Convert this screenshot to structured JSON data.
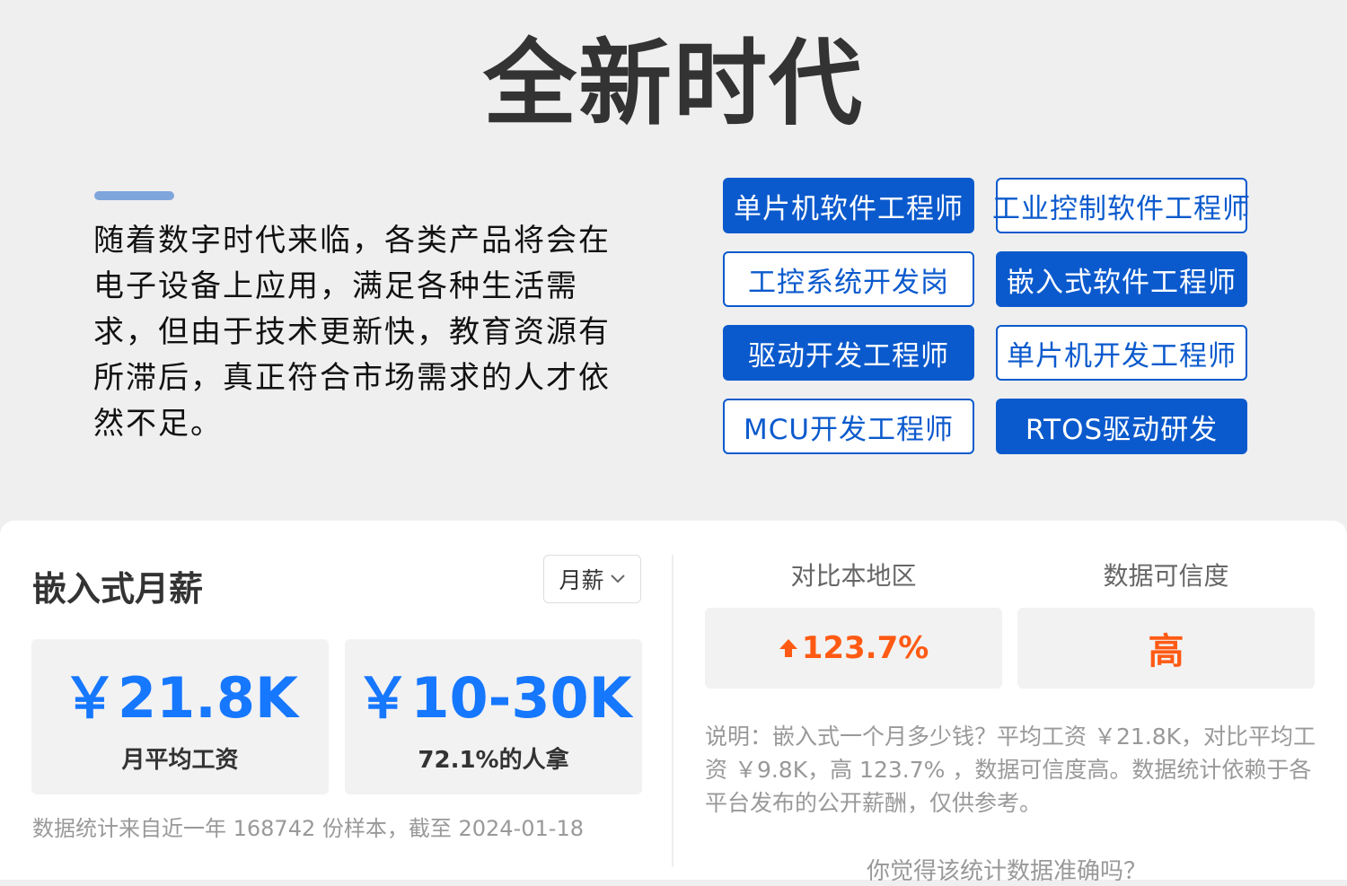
{
  "hero": {
    "title": "全新时代",
    "intro": "随着数字时代来临，各类产品将会在电子设备上应用，满足各种生活需求，但由于技术更新快，教育资源有所滞后，真正符合市场需求的人才依然不足。"
  },
  "tags": [
    {
      "label": "单片机软件工程师",
      "style": "filled"
    },
    {
      "label": "工业控制软件工程师",
      "style": "outline"
    },
    {
      "label": "工控系统开发岗",
      "style": "outline"
    },
    {
      "label": "嵌入式软件工程师",
      "style": "filled"
    },
    {
      "label": "驱动开发工程师",
      "style": "filled"
    },
    {
      "label": "单片机开发工程师",
      "style": "outline"
    },
    {
      "label": "MCU开发工程师",
      "style": "outline"
    },
    {
      "label": "RTOS驱动研发",
      "style": "filled"
    }
  ],
  "salary": {
    "title": "嵌入式月薪",
    "period_selected": "月薪",
    "avg_value": "￥21.8K",
    "avg_label": "月平均工资",
    "range_value": "￥10-30K",
    "range_label": "72.1%的人拿",
    "footnote": "数据统计来自近一年 168742 份样本，截至 2024-01-18"
  },
  "compare": {
    "region_head": "对比本地区",
    "region_value": "123.7%",
    "trust_head": "数据可信度",
    "trust_value": "高",
    "explanation": "说明：嵌入式一个月多少钱？平均工资 ￥21.8K，对比平均工资 ￥9.8K，高 123.7% ，数据可信度高。数据统计依赖于各平台发布的公开薪酬，仅供参考。",
    "question": "你觉得该统计数据准确吗？"
  },
  "colors": {
    "brand_blue": "#0b5acd",
    "value_blue": "#1677ff",
    "highlight_orange": "#ff5a14",
    "accent_bar": "#7fa6dc"
  },
  "icons": {
    "dropdown": "chevron-down-icon",
    "increase": "arrow-up-icon"
  }
}
